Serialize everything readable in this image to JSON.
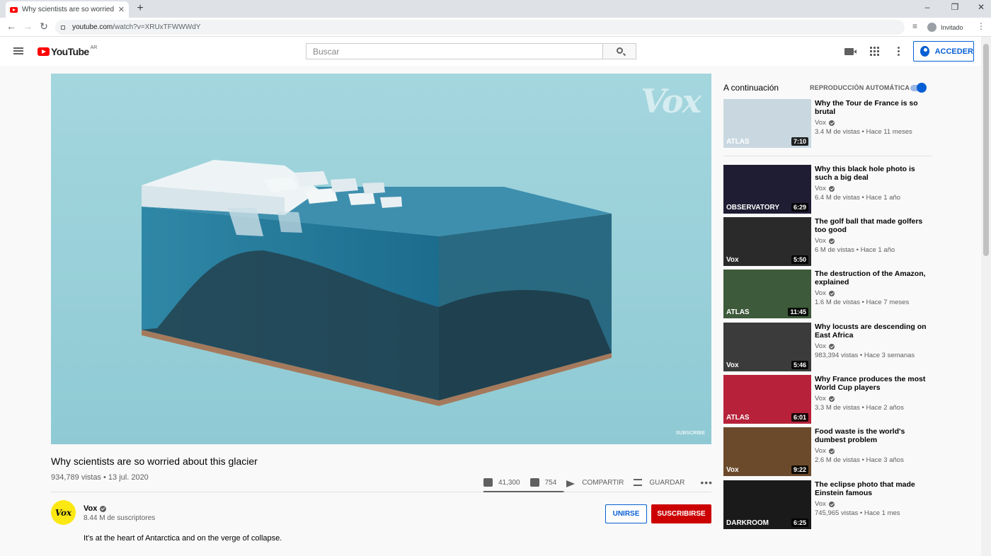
{
  "browser": {
    "tab_title": "Why scientists are so worried ab",
    "new_tab": "+",
    "url_domain": "youtube.com",
    "url_path": "/watch?v=XRUxTFWWWdY",
    "profile_label": "Invitado",
    "minimize": "–",
    "maximize": "❐",
    "close": "✕"
  },
  "header": {
    "logo_word": "YouTube",
    "country_code": "AR",
    "search_placeholder": "Buscar",
    "signin_label": "ACCEDER"
  },
  "video": {
    "watermark": "Vox",
    "subscribe_watermark": "SUBSCRIBE",
    "title": "Why scientists are so worried about this glacier",
    "views": "934,789 vistas",
    "date": "13 jul. 2020",
    "likes": "41,300",
    "dislikes": "754",
    "like_ratio": 0.982,
    "share_label": "COMPARTIR",
    "save_label": "GUARDAR",
    "more_label": "•••"
  },
  "channel": {
    "avatar_text": "Vox",
    "name": "Vox",
    "subscribers": "8.44 M de suscriptores",
    "join_label": "UNIRSE",
    "subscribe_label": "SUSCRIBIRSE",
    "description": "It's at the heart of Antarctica and on the verge of collapse."
  },
  "sidebar": {
    "up_next_label": "A continuación",
    "autoplay_label": "REPRODUCCIÓN AUTOMÁTICA",
    "autoplay_on": true,
    "items": [
      {
        "title": "Why the Tour de France is so brutal",
        "channel": "Vox",
        "stats": "3.4 M de vistas • Hace 11 meses",
        "duration": "7:10",
        "thumb_label": "ATLAS",
        "thumb_color": "#c9d8e0"
      },
      {
        "title": "Why this black hole photo is such a big deal",
        "channel": "Vox",
        "stats": "6.4 M de vistas • Hace 1 año",
        "duration": "6:29",
        "thumb_label": "OBSERVATORY",
        "thumb_color": "#1e1d33"
      },
      {
        "title": "The golf ball that made golfers too good",
        "channel": "Vox",
        "stats": "6 M de vistas • Hace 1 año",
        "duration": "5:50",
        "thumb_label": "Vox",
        "thumb_color": "#2a2a2a"
      },
      {
        "title": "The destruction of the Amazon, explained",
        "channel": "Vox",
        "stats": "1.6 M de vistas • Hace 7 meses",
        "duration": "11:45",
        "thumb_label": "ATLAS",
        "thumb_color": "#3d5a3a"
      },
      {
        "title": "Why locusts are descending on East Africa",
        "channel": "Vox",
        "stats": "983,394 vistas • Hace 3 semanas",
        "duration": "5:46",
        "thumb_label": "Vox",
        "thumb_color": "#3b3b3b"
      },
      {
        "title": "Why France produces the most World Cup players",
        "channel": "Vox",
        "stats": "3.3 M de vistas • Hace 2 años",
        "duration": "6:01",
        "thumb_label": "ATLAS",
        "thumb_color": "#b7223a"
      },
      {
        "title": "Food waste is the world's dumbest problem",
        "channel": "Vox",
        "stats": "2.6 M de vistas • Hace 3 años",
        "duration": "9:22",
        "thumb_label": "Vox",
        "thumb_color": "#6b4a2b"
      },
      {
        "title": "The eclipse photo that made Einstein famous",
        "channel": "Vox",
        "stats": "745,965 vistas • Hace 1 mes",
        "duration": "6:25",
        "thumb_label": "DARKROOM",
        "thumb_color": "#1a1a1a"
      }
    ]
  }
}
